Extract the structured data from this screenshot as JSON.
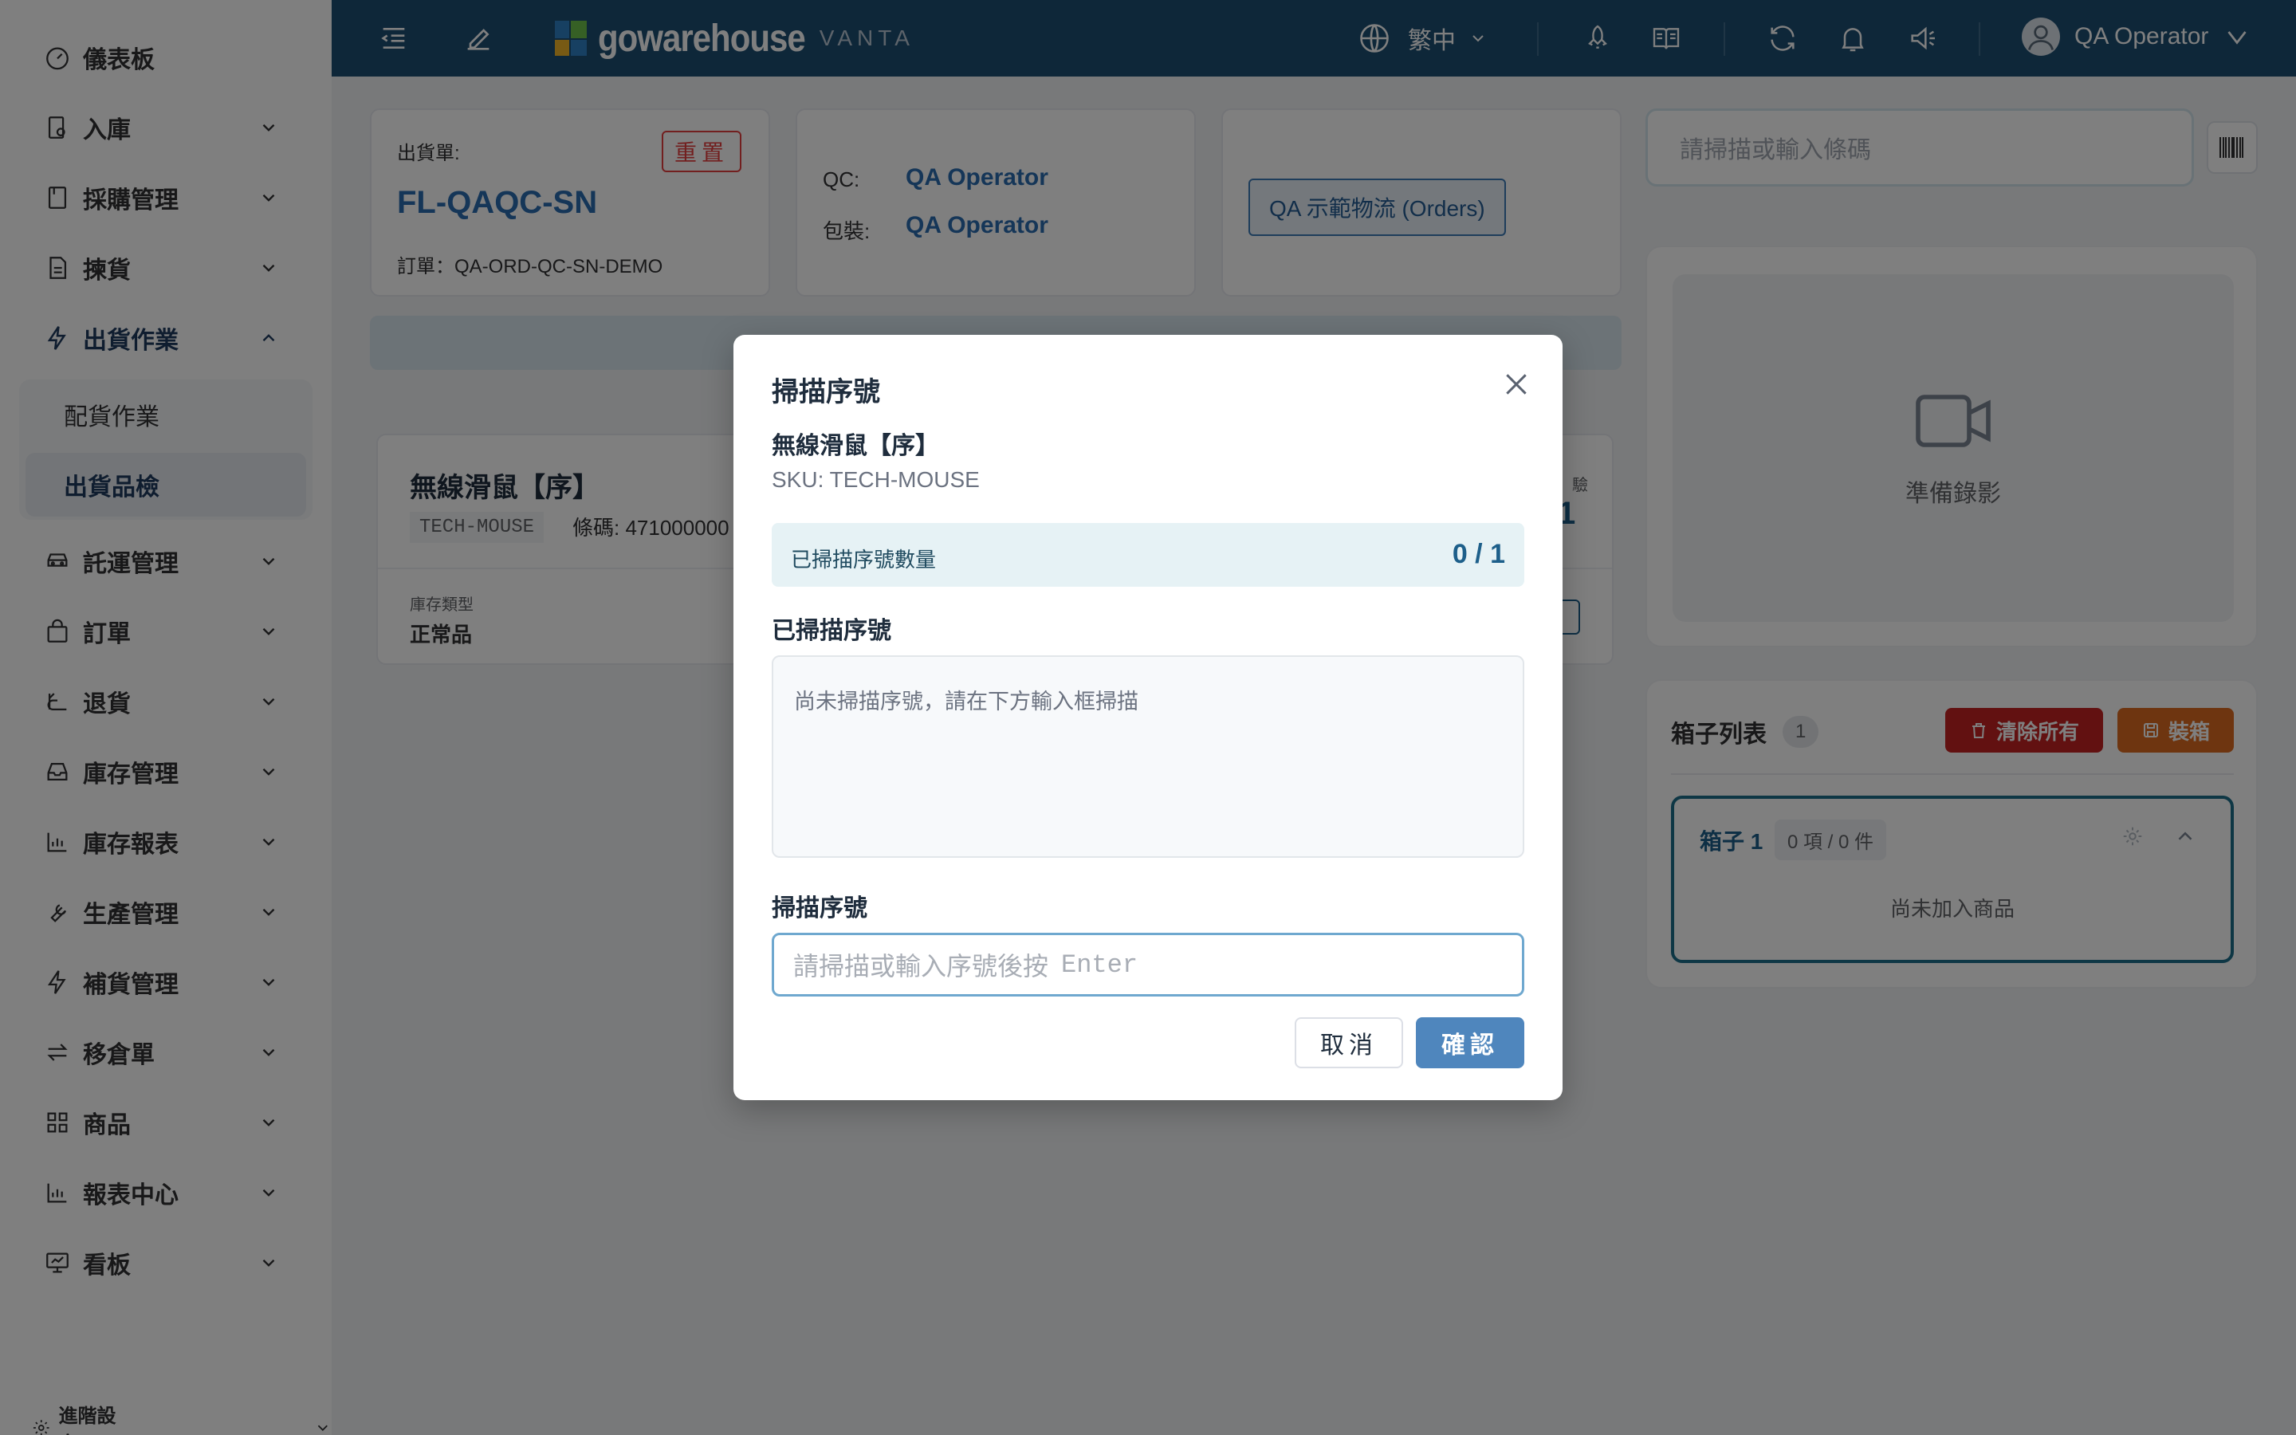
{
  "sidebar": {
    "items": [
      {
        "label": "儀表板",
        "icon": "dashboard-icon"
      },
      {
        "label": "入庫",
        "icon": "inbound-icon"
      },
      {
        "label": "採購管理",
        "icon": "purchase-icon"
      },
      {
        "label": "揀貨",
        "icon": "picking-icon"
      },
      {
        "label": "出貨作業",
        "icon": "lightning-icon"
      },
      {
        "label": "託運管理",
        "icon": "car-icon"
      },
      {
        "label": "訂單",
        "icon": "bag-icon"
      },
      {
        "label": "退貨",
        "icon": "return-icon"
      },
      {
        "label": "庫存管理",
        "icon": "inbox-icon"
      },
      {
        "label": "庫存報表",
        "icon": "bar-chart-icon"
      },
      {
        "label": "生產管理",
        "icon": "wrench-icon"
      },
      {
        "label": "補貨管理",
        "icon": "lightning-icon"
      },
      {
        "label": "移倉單",
        "icon": "transfer-icon"
      },
      {
        "label": "商品",
        "icon": "grid-icon"
      },
      {
        "label": "報表中心",
        "icon": "bar-chart-icon"
      },
      {
        "label": "看板",
        "icon": "monitor-icon"
      }
    ],
    "sub_items": [
      {
        "label": "配貨作業"
      },
      {
        "label": "出貨品檢"
      }
    ],
    "footer_label": "進階設定"
  },
  "header": {
    "brand": "gowarehouse",
    "brand_sub": "VANTA",
    "language": "繁中",
    "user_name": "QA Operator",
    "colors": {
      "bg": "#1d4f73"
    }
  },
  "shipment": {
    "label": "出貨單:",
    "number": "FL-QAQC-SN",
    "reset_label": "重置",
    "order_line": "訂單：QA-ORD-QC-SN-DEMO",
    "qc_label": "QC:",
    "qc_user": "QA Operator",
    "pack_label": "包裝:",
    "pack_user": "QA Operator",
    "carrier_tag": "QA 示範物流 (Orders)"
  },
  "product_card": {
    "name": "無線滑鼠【序】",
    "sku_tag": "TECH-MOUSE",
    "barcode": "條碼: 471000000",
    "stock_type_label": "庫存類型",
    "stock_type_value": "正常品",
    "qty_right_label": "驗",
    "qty_right_value": "1"
  },
  "scan_main": {
    "placeholder": "請掃描或輸入條碼"
  },
  "video": {
    "label": "準備錄影"
  },
  "box_panel": {
    "title": "箱子列表",
    "count": "1",
    "clear_label": "清除所有",
    "pack_label": "裝箱",
    "box_name": "箱子 1",
    "box_meta": "0 項 / 0 件",
    "box_empty": "尚未加入商品"
  },
  "modal": {
    "title": "掃描序號",
    "product_name": "無線滑鼠【序】",
    "sku": "SKU: TECH-MOUSE",
    "count_label": "已掃描序號數量",
    "count_value": "0 / 1",
    "scanned_title": "已掃描序號",
    "scanned_empty": "尚未掃描序號，請在下方輸入框掃描",
    "input_title": "掃描序號",
    "input_placeholder": "請掃描或輸入序號後按",
    "input_placeholder_key": "Enter",
    "cancel_label": "取消",
    "confirm_label": "確認"
  }
}
